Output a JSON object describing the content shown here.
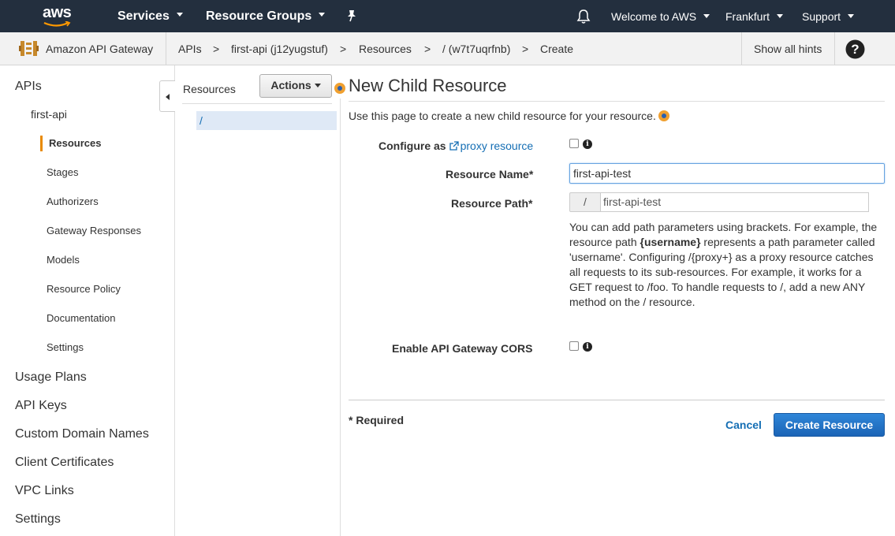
{
  "topnav": {
    "logo_text": "aws",
    "services_label": "Services",
    "resource_groups_label": "Resource Groups",
    "welcome_label": "Welcome to AWS",
    "region_label": "Frankfurt",
    "support_label": "Support",
    "icons": [
      "pin-icon",
      "bell-icon"
    ]
  },
  "breadcrumb": {
    "service_name": "Amazon API Gateway",
    "items": [
      "APIs",
      "first-api (j12yugstuf)",
      "Resources",
      "/ (w7t7uqrfnb)",
      "Create"
    ],
    "separator": ">",
    "hints_label": "Show all hints"
  },
  "leftnav": {
    "apis": "APIs",
    "api_name": "first-api",
    "active_item": "Resources",
    "sub_items": [
      "Stages",
      "Authorizers",
      "Gateway Responses",
      "Models",
      "Resource Policy",
      "Documentation",
      "Settings"
    ],
    "bottom_items": [
      "Usage Plans",
      "API Keys",
      "Custom Domain Names",
      "Client Certificates",
      "VPC Links",
      "Settings"
    ]
  },
  "resources_panel": {
    "title": "Resources",
    "actions_label": "Actions",
    "selected_resource": "/"
  },
  "form": {
    "title": "New Child Resource",
    "intro": "Use this page to create a new child resource for your resource.",
    "configure_label": "Configure as",
    "proxy_link": "proxy resource",
    "resource_name_label": "Resource Name*",
    "resource_name_value": "first-api-test",
    "resource_path_label": "Resource Path*",
    "resource_path_prefix": "/",
    "resource_path_value": "first-api-test",
    "help_before": "You can add path parameters using brackets. For example, the resource path ",
    "help_bold": "{username}",
    "help_after": " represents a path parameter called 'username'. Configuring /{proxy+} as a proxy resource catches all requests to its sub-resources. For example, it works for a GET request to /foo. To handle requests to /, add a new ANY method on the / resource.",
    "cors_label": "Enable API Gateway CORS",
    "required_note": "* Required",
    "cancel_label": "Cancel",
    "create_label": "Create Resource",
    "proxy_checked": false,
    "cors_checked": false
  },
  "colors": {
    "topnav_bg": "#232f3e",
    "link": "#146eb4",
    "accent": "#e98a00",
    "primary_button": "#1b64b6"
  }
}
